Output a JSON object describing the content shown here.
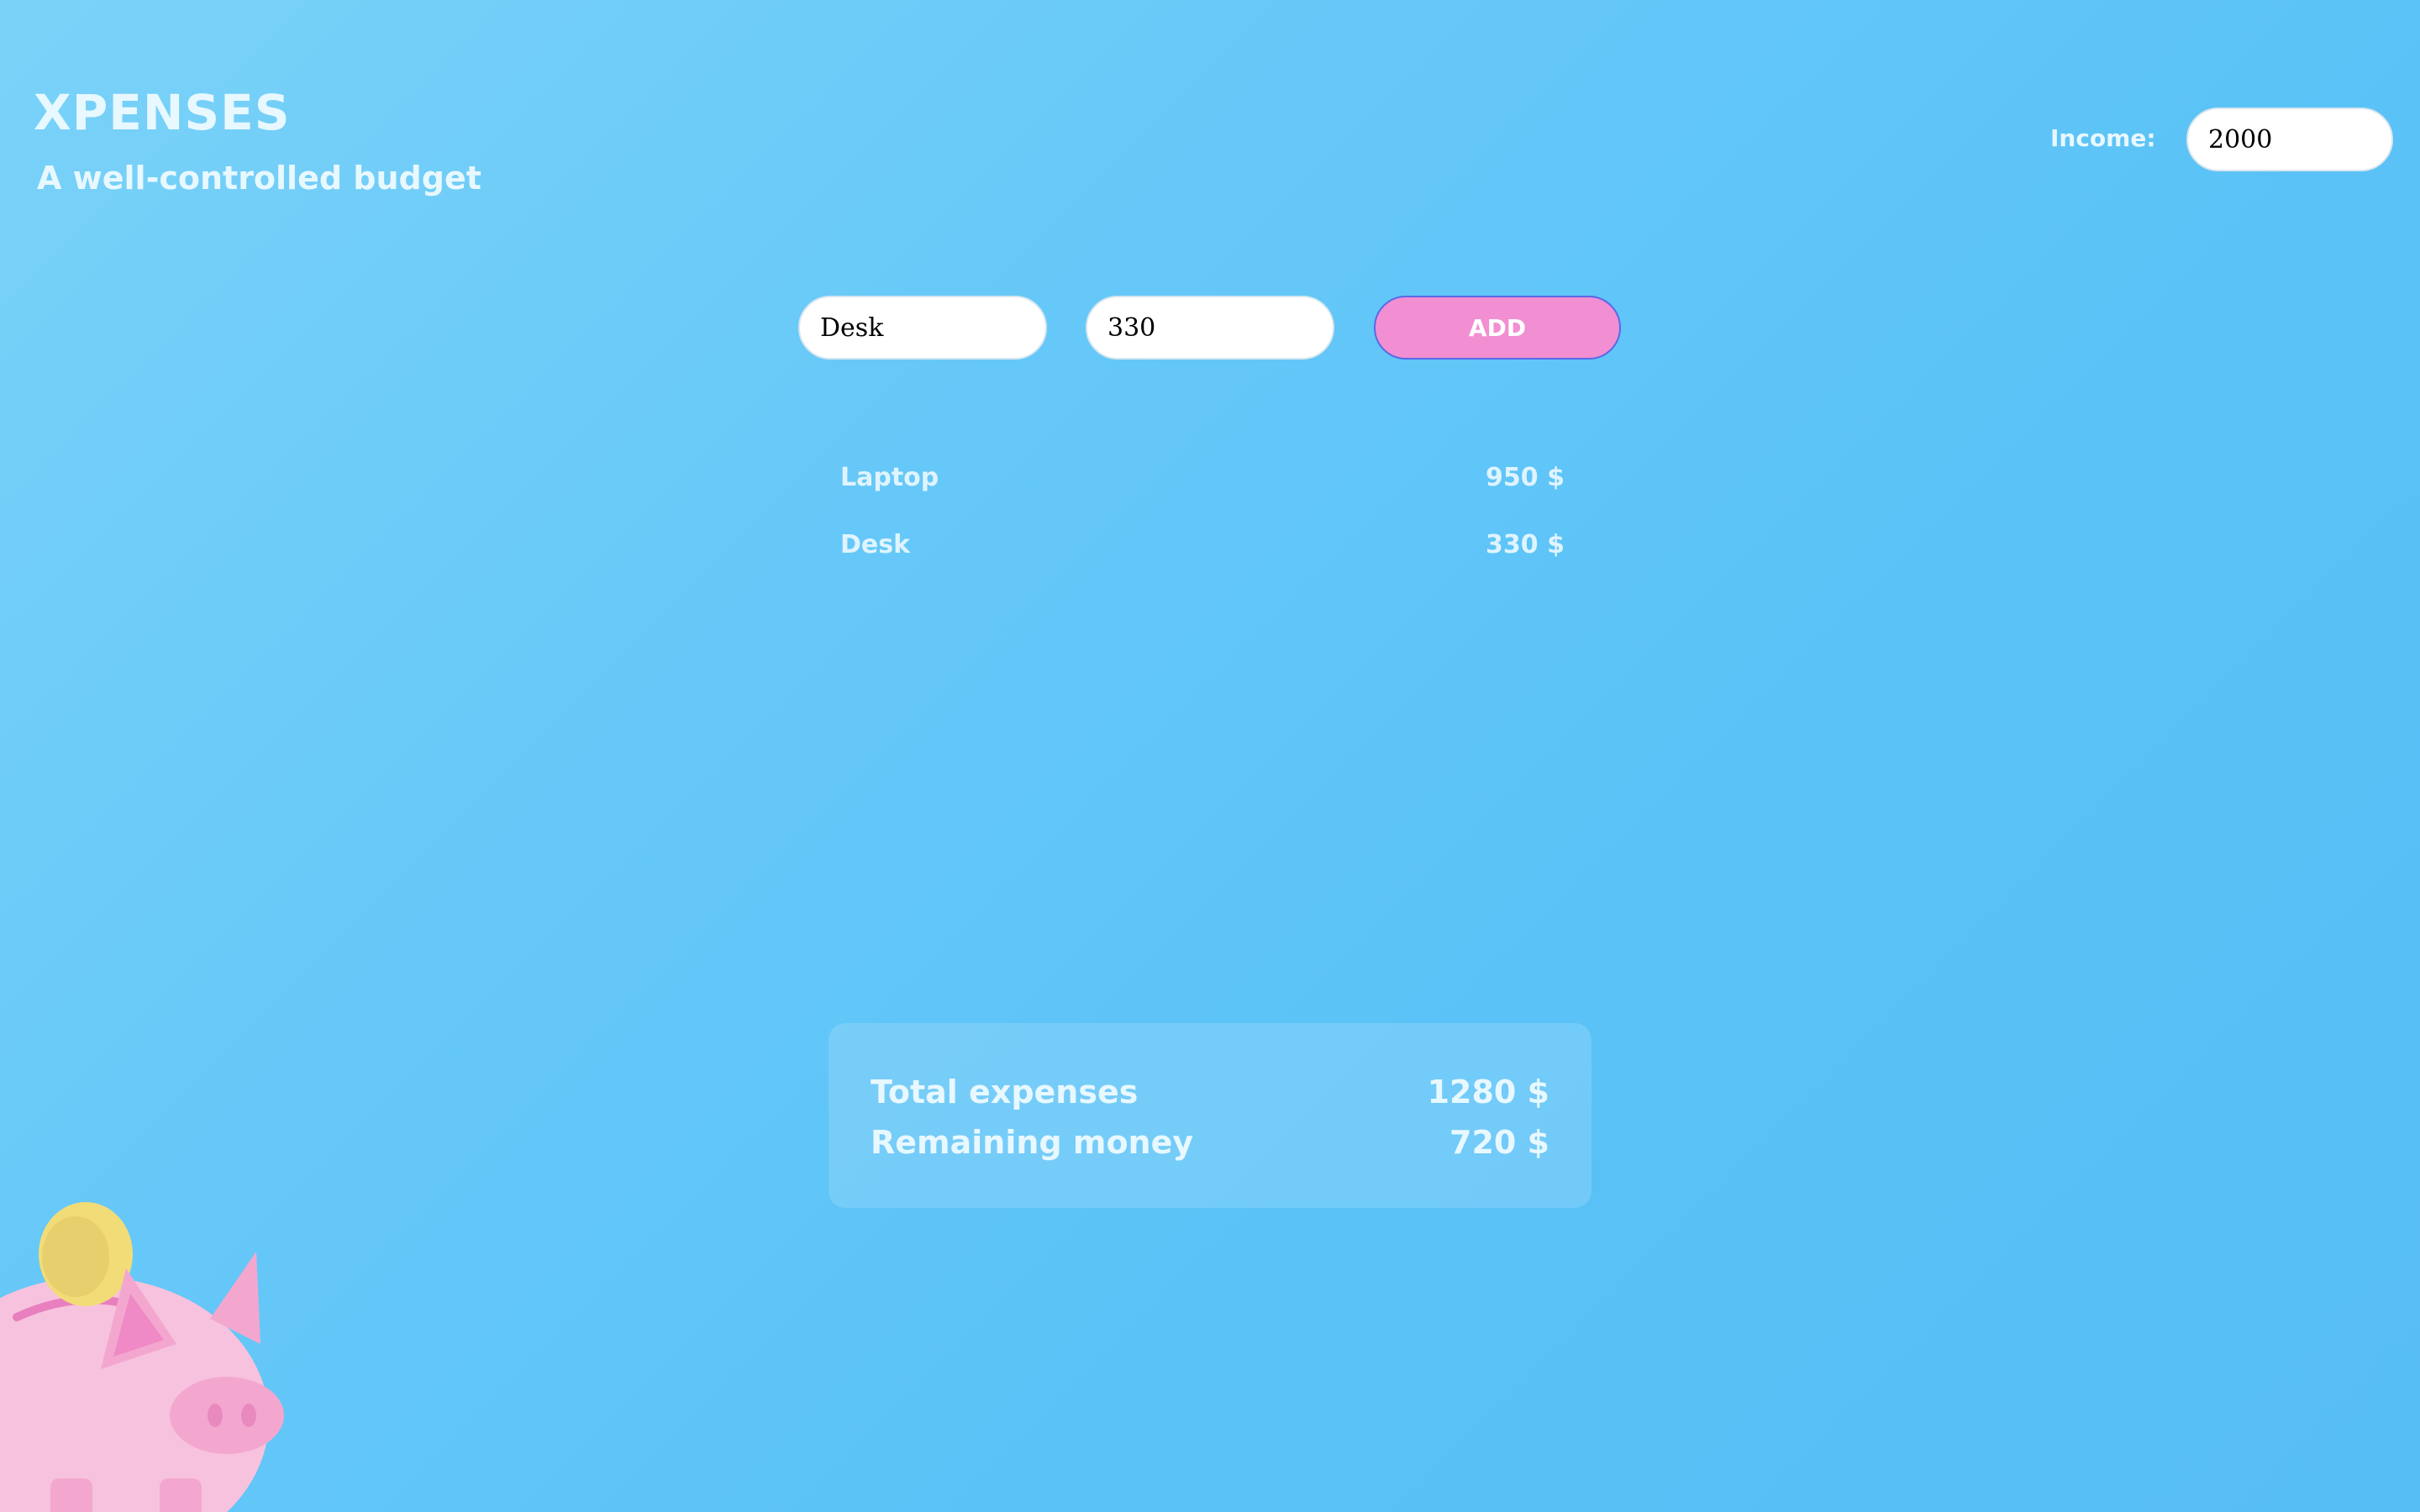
{
  "header": {
    "title": "XPENSES",
    "subtitle": "A well-controlled budget"
  },
  "income": {
    "label": "Income:",
    "value": "2000"
  },
  "form": {
    "name_value": "Desk",
    "amount_value": "330",
    "add_label": "ADD"
  },
  "expenses": [
    {
      "name": "Laptop",
      "amount": "950 $"
    },
    {
      "name": "Desk",
      "amount": "330 $"
    }
  ],
  "summary": {
    "total_label": "Total expenses",
    "total_value": "1280 $",
    "remaining_label": "Remaining money",
    "remaining_value": "720 $"
  },
  "illustration": {
    "icon": "piggy-bank-icon",
    "pig_color": "#f7c2dd",
    "coin_color": "#f2dc78"
  }
}
